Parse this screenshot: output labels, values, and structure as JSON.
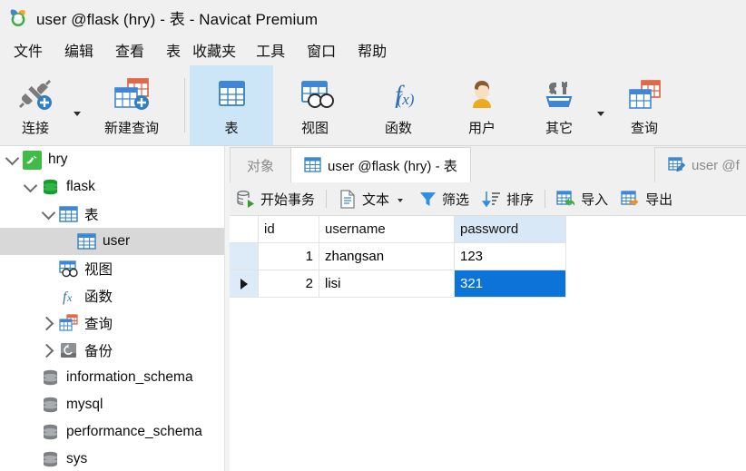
{
  "window": {
    "title": "user @flask (hry) - 表 - Navicat Premium",
    "logo_icon": "navicat-logo-icon"
  },
  "menubar": {
    "items": [
      {
        "label": "文件",
        "name": "menu-file"
      },
      {
        "label": "编辑",
        "name": "menu-edit"
      },
      {
        "label": "查看",
        "name": "menu-view"
      },
      {
        "label": "表",
        "name": "menu-table"
      },
      {
        "label": "收藏夹",
        "name": "menu-favorites"
      },
      {
        "label": "工具",
        "name": "menu-tools"
      },
      {
        "label": "窗口",
        "name": "menu-window"
      },
      {
        "label": "帮助",
        "name": "menu-help"
      }
    ]
  },
  "toolbar": {
    "buttons": [
      {
        "label": "连接",
        "icon": "connection-plug-icon",
        "selected": false,
        "has_caret": true
      },
      {
        "label": "新建查询",
        "icon": "new-query-icon",
        "selected": false,
        "has_caret": false
      },
      {
        "label": "表",
        "icon": "table-icon",
        "selected": true,
        "has_caret": false
      },
      {
        "label": "视图",
        "icon": "view-icon",
        "selected": false,
        "has_caret": false
      },
      {
        "label": "函数",
        "icon": "function-fx-icon",
        "selected": false,
        "has_caret": false
      },
      {
        "label": "用户",
        "icon": "user-icon",
        "selected": false,
        "has_caret": false
      },
      {
        "label": "其它",
        "icon": "other-tools-icon",
        "selected": false,
        "has_caret": true
      },
      {
        "label": "查询",
        "icon": "query-icon",
        "selected": false,
        "has_caret": false
      }
    ]
  },
  "sidebar": {
    "items": [
      {
        "label": "hry",
        "icon": "mysql-connection-icon",
        "indent": 0,
        "twisty": "open",
        "selected": false
      },
      {
        "label": "flask",
        "icon": "database-green-icon",
        "indent": 1,
        "twisty": "open",
        "selected": false
      },
      {
        "label": "表",
        "icon": "table-icon",
        "indent": 2,
        "twisty": "open",
        "selected": false
      },
      {
        "label": "user",
        "icon": "table-icon",
        "indent": 3,
        "twisty": "none",
        "selected": true
      },
      {
        "label": "视图",
        "icon": "view-icon",
        "indent": 2,
        "twisty": "none",
        "selected": false
      },
      {
        "label": "函数",
        "icon": "function-fx-icon",
        "indent": 2,
        "twisty": "none",
        "selected": false
      },
      {
        "label": "查询",
        "icon": "query-icon",
        "indent": 2,
        "twisty": "closed",
        "selected": false
      },
      {
        "label": "备份",
        "icon": "backup-icon",
        "indent": 2,
        "twisty": "closed",
        "selected": false
      },
      {
        "label": "information_schema",
        "icon": "database-grey-icon",
        "indent": 1,
        "twisty": "none",
        "selected": false
      },
      {
        "label": "mysql",
        "icon": "database-grey-icon",
        "indent": 1,
        "twisty": "none",
        "selected": false
      },
      {
        "label": "performance_schema",
        "icon": "database-grey-icon",
        "indent": 1,
        "twisty": "none",
        "selected": false
      },
      {
        "label": "sys",
        "icon": "database-grey-icon",
        "indent": 1,
        "twisty": "none",
        "selected": false
      }
    ]
  },
  "tabs": [
    {
      "label": "对象",
      "icon": "none",
      "active": false,
      "name": "tab-objects"
    },
    {
      "label": "user @flask (hry) - 表",
      "icon": "table-icon",
      "active": true,
      "name": "tab-table-data"
    },
    {
      "label": "user @f",
      "icon": "table-design-icon",
      "active": false,
      "name": "tab-table-design"
    }
  ],
  "data_toolbar": {
    "buttons": [
      {
        "label": "开始事务",
        "icon": "begin-transaction-icon",
        "has_caret": false
      },
      {
        "label": "文本",
        "icon": "text-document-icon",
        "has_caret": true
      },
      {
        "label": "筛选",
        "icon": "filter-funnel-icon",
        "has_caret": false
      },
      {
        "label": "排序",
        "icon": "sort-icon",
        "has_caret": false
      },
      {
        "label": "导入",
        "icon": "import-icon",
        "has_caret": false
      },
      {
        "label": "导出",
        "icon": "export-icon",
        "has_caret": false
      }
    ]
  },
  "grid": {
    "columns": [
      "id",
      "username",
      "password"
    ],
    "highlighted_column": "password",
    "rows": [
      {
        "marker": false,
        "id": "1",
        "username": "zhangsan",
        "password": "123",
        "selected_cell": null
      },
      {
        "marker": true,
        "id": "2",
        "username": "lisi",
        "password": "321",
        "selected_cell": "password"
      }
    ]
  },
  "colors": {
    "accent_selection": "#0c73d8",
    "toolbar_selected": "#cde6f7",
    "tree_selected": "#d8d8d8",
    "column_highlight": "#d9e8f7",
    "chrome": "#f0f0f0"
  }
}
